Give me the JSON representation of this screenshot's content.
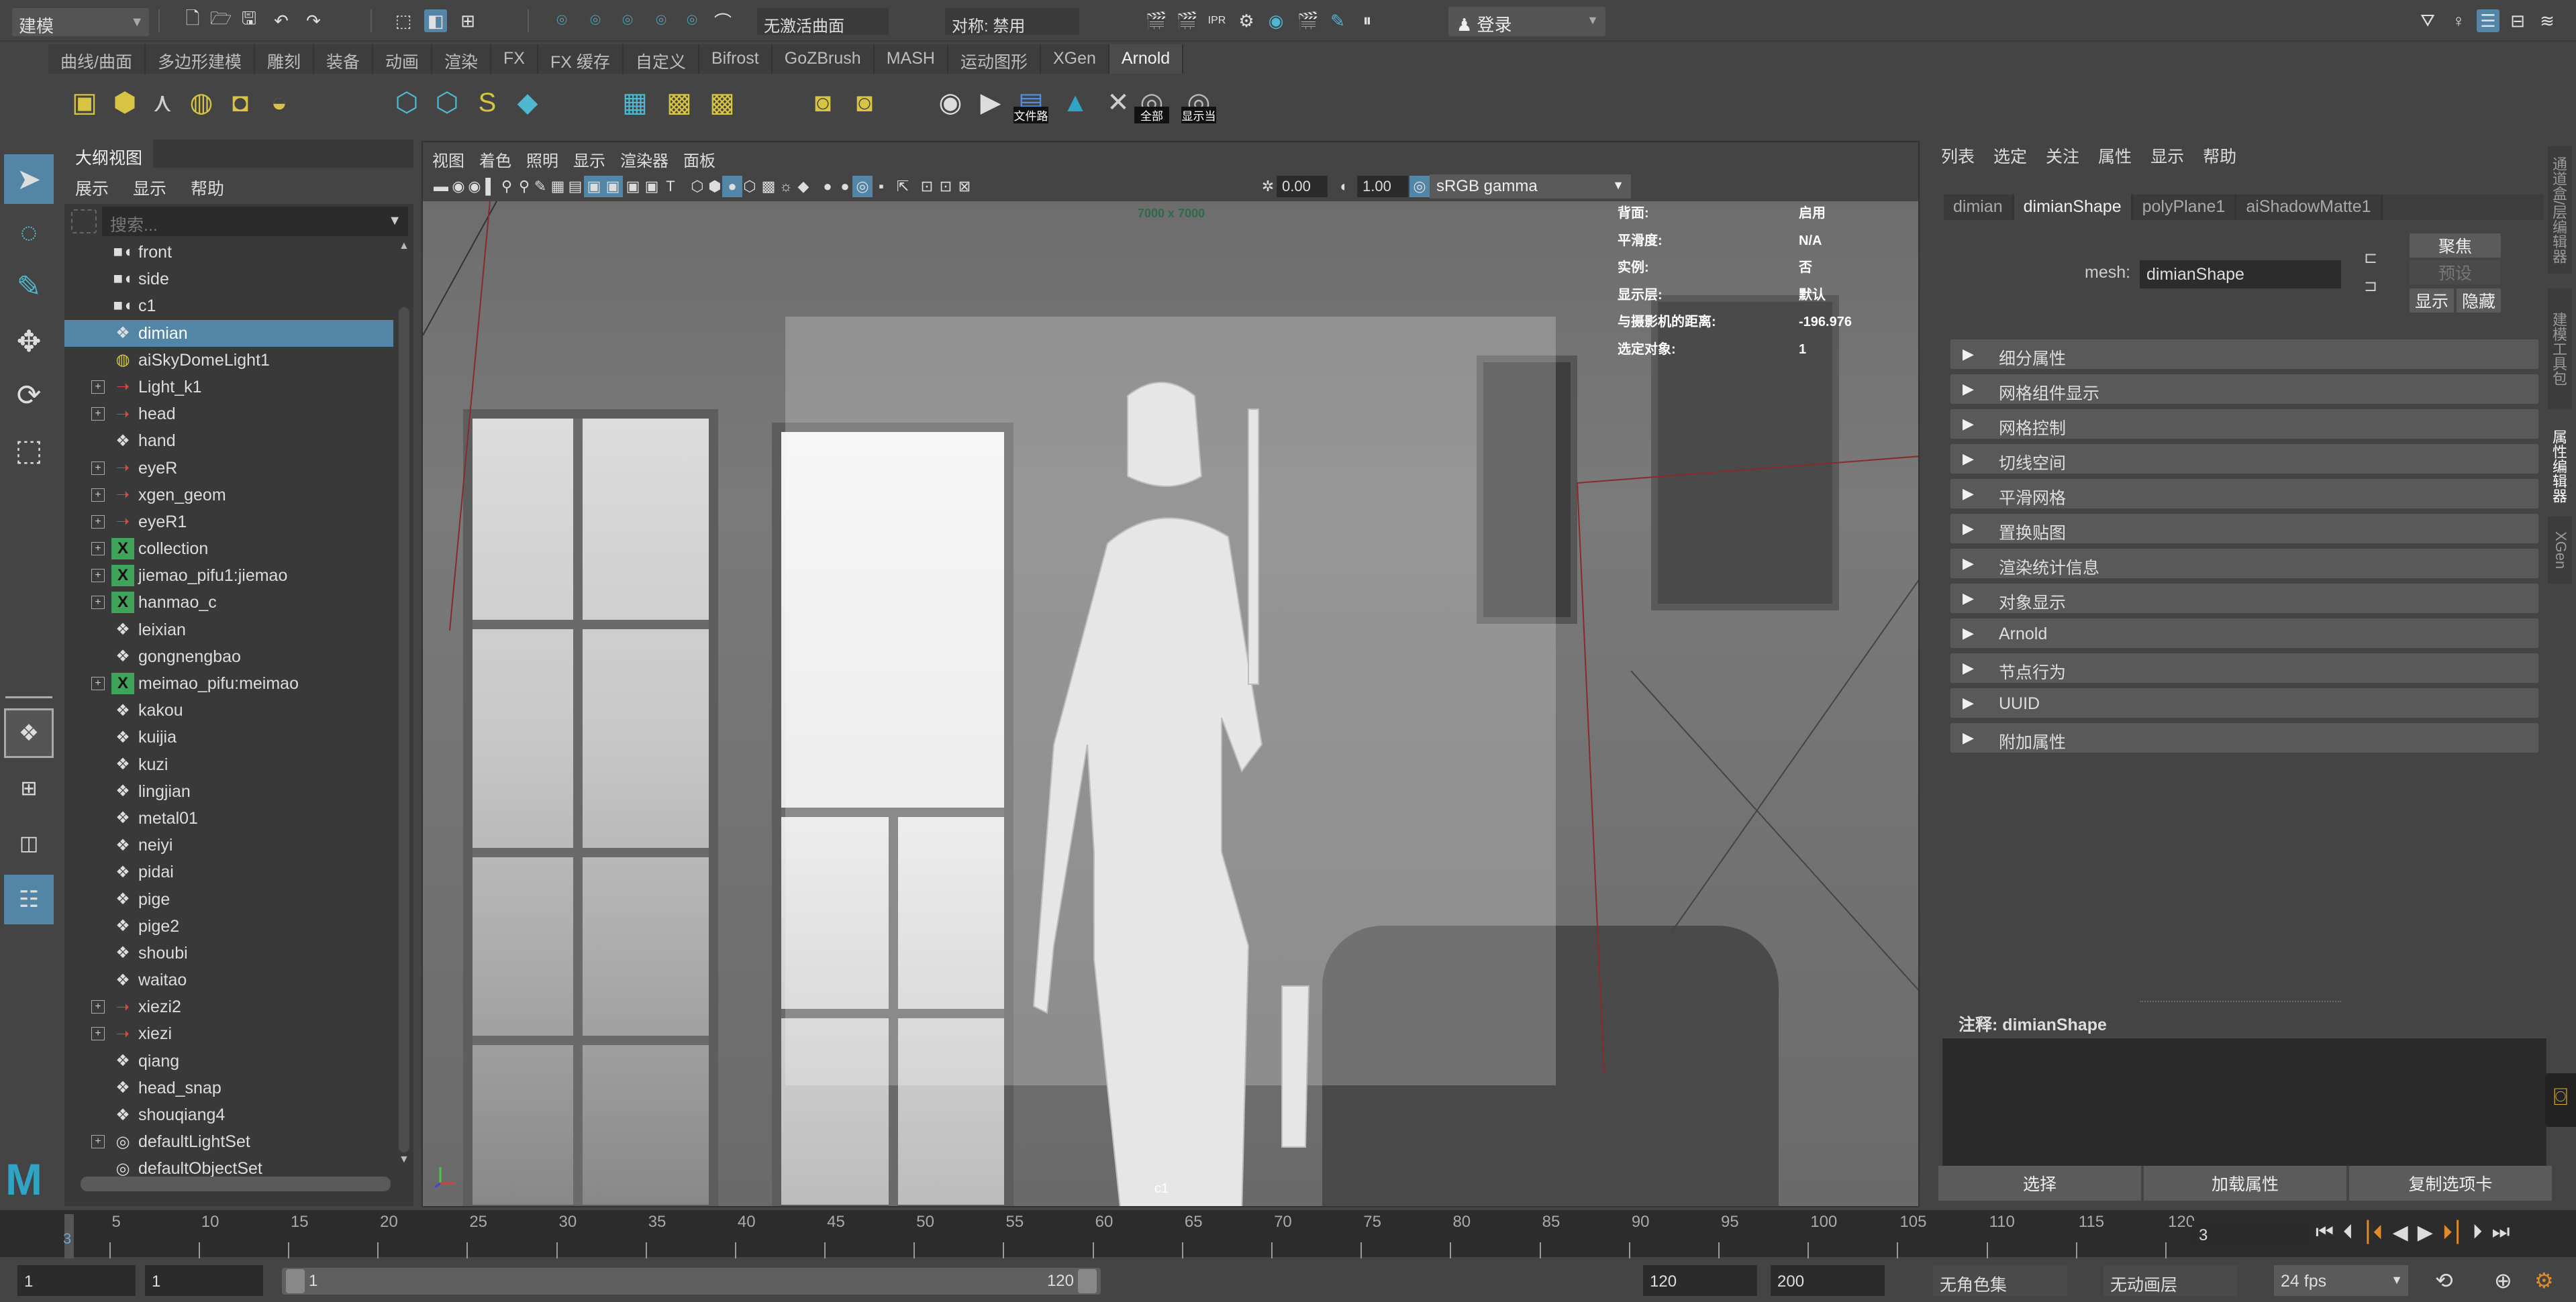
{
  "statusline": {
    "mode": "建模",
    "live_surface": "无激活曲面",
    "symmetry": "对称: 禁用",
    "login": "登录"
  },
  "shelf": {
    "tabs": [
      "曲线/曲面",
      "多边形建模",
      "雕刻",
      "装备",
      "动画",
      "渲染",
      "FX",
      "FX 缓存",
      "自定义",
      "Bifrost",
      "GoZBrush",
      "MASH",
      "运动图形",
      "XGen",
      "Arnold"
    ],
    "active_tab": "Arnold",
    "icons": [
      {
        "name": "area-light-icon",
        "glyph": "▣",
        "color": "#d8c443"
      },
      {
        "name": "mesh-light-icon",
        "glyph": "⬢",
        "color": "#d8c443"
      },
      {
        "name": "photometric-light-icon",
        "glyph": "⋏",
        "color": "#cfcfcf"
      },
      {
        "name": "skydome-light-icon",
        "glyph": "◍",
        "color": "#d8c443"
      },
      {
        "name": "portal-light-icon",
        "glyph": "◘",
        "color": "#d8c443"
      },
      {
        "name": "physical-sky-icon",
        "glyph": "◒",
        "color": "#d8c443"
      },
      {
        "name": "stand-in-icon",
        "glyph": "⬡",
        "color": "#4fb7cf"
      },
      {
        "name": "export-stand-in-icon",
        "glyph": "⬡",
        "color": "#4fb7cf"
      },
      {
        "name": "curve-collector-icon",
        "glyph": "S",
        "color": "#d8c443"
      },
      {
        "name": "volume-icon",
        "glyph": "◆",
        "color": "#4fb7cf"
      },
      {
        "name": "render-view-icon",
        "glyph": "▦",
        "color": "#4fb7cf"
      },
      {
        "name": "tx-manager-icon",
        "glyph": "▩",
        "color": "#d8c443"
      },
      {
        "name": "flush-textures-icon",
        "glyph": "▩",
        "color": "#d8c443"
      },
      {
        "name": "light-manager-icon",
        "glyph": "◙",
        "color": "#d8c443"
      },
      {
        "name": "shader-manager-icon",
        "glyph": "◙",
        "color": "#d8c443"
      },
      {
        "name": "render-sequence-icon",
        "glyph": "◉",
        "color": "#dddddd"
      },
      {
        "name": "render-play-icon",
        "glyph": "▶",
        "color": "#dddddd"
      },
      {
        "name": "file-path-icon",
        "glyph": "▤",
        "color": "#4f8fdf",
        "label": "文件路"
      },
      {
        "name": "arnold-logo-icon",
        "glyph": "▲",
        "color": "#2fa4c4"
      },
      {
        "name": "xgen-tool-icon",
        "glyph": "✕",
        "color": "#cfcfcf"
      },
      {
        "name": "show-all-icon",
        "glyph": "◎",
        "color": "#bbbbbb",
        "label": "全部"
      },
      {
        "name": "show-current-icon",
        "glyph": "◎",
        "color": "#bbbbbb",
        "label": "显示当"
      }
    ]
  },
  "outliner": {
    "title": "大纲视图",
    "menu": [
      "展示",
      "显示",
      "帮助"
    ],
    "search_placeholder": "搜索...",
    "items": [
      {
        "label": "front",
        "icon": "camera-icon",
        "expandable": false
      },
      {
        "label": "side",
        "icon": "camera-icon",
        "expandable": false
      },
      {
        "label": "c1",
        "icon": "camera-icon",
        "expandable": false
      },
      {
        "label": "dimian",
        "icon": "mesh-icon",
        "expandable": false,
        "selected": true
      },
      {
        "label": "aiSkyDomeLight1",
        "icon": "skydome-icon",
        "expandable": false
      },
      {
        "label": "Light_k1",
        "icon": "group-icon",
        "expandable": true
      },
      {
        "label": "head",
        "icon": "group-icon",
        "expandable": true
      },
      {
        "label": "hand",
        "icon": "mesh-icon",
        "expandable": false
      },
      {
        "label": "eyeR",
        "icon": "group-icon",
        "expandable": true
      },
      {
        "label": "xgen_geom",
        "icon": "group-icon",
        "expandable": true
      },
      {
        "label": "eyeR1",
        "icon": "group-icon",
        "expandable": true
      },
      {
        "label": "collection",
        "icon": "xgen-icon",
        "expandable": true
      },
      {
        "label": "jiemao_pifu1:jiemao",
        "icon": "xgen-icon",
        "expandable": true
      },
      {
        "label": "hanmao_c",
        "icon": "xgen-icon",
        "expandable": true
      },
      {
        "label": "leixian",
        "icon": "mesh-icon",
        "expandable": false
      },
      {
        "label": "gongnengbao",
        "icon": "mesh-icon",
        "expandable": false
      },
      {
        "label": "meimao_pifu:meimao",
        "icon": "xgen-icon",
        "expandable": true
      },
      {
        "label": "kakou",
        "icon": "mesh-icon",
        "expandable": false
      },
      {
        "label": "kuijia",
        "icon": "mesh-icon",
        "expandable": false
      },
      {
        "label": "kuzi",
        "icon": "mesh-icon",
        "expandable": false
      },
      {
        "label": "lingjian",
        "icon": "mesh-icon",
        "expandable": false
      },
      {
        "label": "metal01",
        "icon": "mesh-icon",
        "expandable": false
      },
      {
        "label": "neiyi",
        "icon": "mesh-icon",
        "expandable": false
      },
      {
        "label": "pidai",
        "icon": "mesh-icon",
        "expandable": false
      },
      {
        "label": "pige",
        "icon": "mesh-icon",
        "expandable": false
      },
      {
        "label": "pige2",
        "icon": "mesh-icon",
        "expandable": false
      },
      {
        "label": "shoubi",
        "icon": "mesh-icon",
        "expandable": false
      },
      {
        "label": "waitao",
        "icon": "mesh-icon",
        "expandable": false
      },
      {
        "label": "xiezi2",
        "icon": "group-icon",
        "expandable": true
      },
      {
        "label": "xiezi",
        "icon": "group-icon",
        "expandable": true
      },
      {
        "label": "qiang",
        "icon": "mesh-icon",
        "expandable": false
      },
      {
        "label": "head_snap",
        "icon": "mesh-icon",
        "expandable": false
      },
      {
        "label": "shouqiang4",
        "icon": "mesh-icon",
        "expandable": false
      },
      {
        "label": "defaultLightSet",
        "icon": "set-icon",
        "expandable": true
      },
      {
        "label": "defaultObjectSet",
        "icon": "set-icon",
        "expandable": false
      }
    ]
  },
  "viewport": {
    "menu": [
      "视图",
      "着色",
      "照明",
      "显示",
      "渲染器",
      "面板"
    ],
    "exposure": "0.00",
    "gamma": "1.00",
    "color_space": "sRGB gamma",
    "resolution_gate": "7000 x 7000",
    "camera_name": "c1",
    "hud": [
      {
        "key": "背面:",
        "value": "启用"
      },
      {
        "key": "平滑度:",
        "value": "N/A"
      },
      {
        "key": "实例:",
        "value": "否"
      },
      {
        "key": "显示层:",
        "value": "默认"
      },
      {
        "key": "与摄影机的距离:",
        "value": "-196.976"
      },
      {
        "key": "选定对象:",
        "value": "1"
      }
    ]
  },
  "attribute_editor": {
    "menu": [
      "列表",
      "选定",
      "关注",
      "属性",
      "显示",
      "帮助"
    ],
    "tabs": [
      "dimian",
      "dimianShape",
      "polyPlane1",
      "aiShadowMatte1"
    ],
    "active_tab": "dimianShape",
    "mesh_label": "mesh:",
    "mesh_value": "dimianShape",
    "focus_button": "聚焦",
    "presets_button": "预设",
    "show_button": "显示",
    "hide_button": "隐藏",
    "sections": [
      "细分属性",
      "网格组件显示",
      "网格控制",
      "切线空间",
      "平滑网格",
      "置换贴图",
      "渲染统计信息",
      "对象显示",
      "Arnold",
      "节点行为",
      "UUID",
      "附加属性"
    ],
    "notes_label": "注释:",
    "notes_node": "dimianShape",
    "bottom_buttons": [
      "选择",
      "加载属性",
      "复制选项卡"
    ]
  },
  "side_tabs": [
    {
      "label": "通道盒/层编辑器",
      "active": false
    },
    {
      "label": "建模工具包",
      "active": false
    },
    {
      "label": "属性编辑器",
      "active": true
    },
    {
      "label": "XGen",
      "active": false
    }
  ],
  "time_slider": {
    "ticks": [
      5,
      10,
      15,
      20,
      25,
      30,
      35,
      40,
      45,
      50,
      55,
      60,
      65,
      70,
      75,
      80,
      85,
      90,
      95,
      100,
      105,
      110,
      115,
      120
    ],
    "range_start": 1,
    "range_end": 120,
    "current_frame": "3",
    "current_frame_field": "3"
  },
  "range_slider": {
    "start_frame": "1",
    "playback_start": "1",
    "range_min_label": "1",
    "range_max_label": "120",
    "playback_end": "120",
    "end_frame": "200",
    "character_set": "无角色集",
    "anim_layer": "无动画层",
    "fps": "24 fps"
  },
  "colors": {
    "accent": "#5285a6",
    "arnold_yellow": "#d8c443",
    "arnold_cyan": "#4fb7cf",
    "keyframe_orange": "#e08a2a"
  }
}
